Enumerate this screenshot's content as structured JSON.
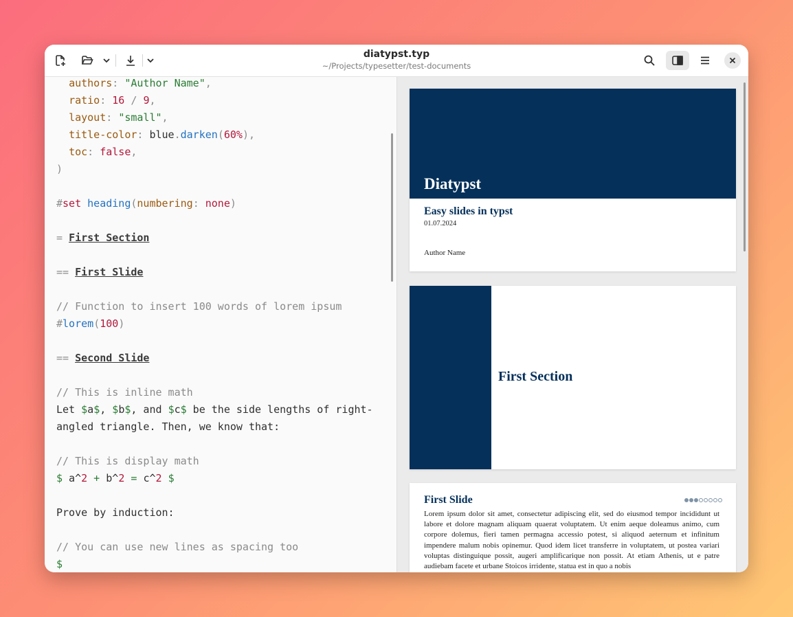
{
  "window": {
    "title": "diatypst.typ",
    "subtitle": "~/Projects/typesetter/test-documents"
  },
  "toolbar": {
    "new_icon": "new-document-icon",
    "open_icon": "folder-open-icon",
    "open_more_icon": "chevron-down-icon",
    "export_icon": "download-icon",
    "export_more_icon": "chevron-down-icon",
    "search_icon": "search-icon",
    "preview_toggle_icon": "sidebar-toggle-icon",
    "menu_icon": "hamburger-menu-icon",
    "close_icon": "close-icon"
  },
  "editor": {
    "lines": [
      [
        {
          "t": "  "
        },
        {
          "t": "authors",
          "c": "k"
        },
        {
          "t": ": ",
          "c": "p"
        },
        {
          "t": "\"Author Name\"",
          "c": "s"
        },
        {
          "t": ",",
          "c": "p"
        }
      ],
      [
        {
          "t": "  "
        },
        {
          "t": "ratio",
          "c": "k"
        },
        {
          "t": ": ",
          "c": "p"
        },
        {
          "t": "16",
          "c": "n"
        },
        {
          "t": " / ",
          "c": "p"
        },
        {
          "t": "9",
          "c": "n"
        },
        {
          "t": ",",
          "c": "p"
        }
      ],
      [
        {
          "t": "  "
        },
        {
          "t": "layout",
          "c": "k"
        },
        {
          "t": ": ",
          "c": "p"
        },
        {
          "t": "\"small\"",
          "c": "s"
        },
        {
          "t": ",",
          "c": "p"
        }
      ],
      [
        {
          "t": "  "
        },
        {
          "t": "title-color",
          "c": "k"
        },
        {
          "t": ": ",
          "c": "p"
        },
        {
          "t": "blue"
        },
        {
          "t": ".",
          "c": "p"
        },
        {
          "t": "darken",
          "c": "f"
        },
        {
          "t": "(",
          "c": "p"
        },
        {
          "t": "60%",
          "c": "n"
        },
        {
          "t": "),",
          "c": "p"
        }
      ],
      [
        {
          "t": "  "
        },
        {
          "t": "toc",
          "c": "k"
        },
        {
          "t": ": ",
          "c": "p"
        },
        {
          "t": "false",
          "c": "n"
        },
        {
          "t": ",",
          "c": "p"
        }
      ],
      [
        {
          "t": ")",
          "c": "p"
        }
      ],
      [
        {
          "t": ""
        }
      ],
      [
        {
          "t": "#",
          "c": "p"
        },
        {
          "t": "set",
          "c": "kw"
        },
        {
          "t": " "
        },
        {
          "t": "heading",
          "c": "f"
        },
        {
          "t": "(",
          "c": "p"
        },
        {
          "t": "numbering",
          "c": "k"
        },
        {
          "t": ": ",
          "c": "p"
        },
        {
          "t": "none",
          "c": "n"
        },
        {
          "t": ")",
          "c": "p"
        }
      ],
      [
        {
          "t": ""
        }
      ],
      [
        {
          "t": "= ",
          "c": "p"
        },
        {
          "t": "First Section",
          "c": "h"
        }
      ],
      [
        {
          "t": ""
        }
      ],
      [
        {
          "t": "== ",
          "c": "p"
        },
        {
          "t": "First Slide",
          "c": "h"
        }
      ],
      [
        {
          "t": ""
        }
      ],
      [
        {
          "t": "// Function to insert 100 words of lorem ipsum",
          "c": "c"
        }
      ],
      [
        {
          "t": "#",
          "c": "p"
        },
        {
          "t": "lorem",
          "c": "f"
        },
        {
          "t": "(",
          "c": "p"
        },
        {
          "t": "100",
          "c": "n"
        },
        {
          "t": ")",
          "c": "p"
        }
      ],
      [
        {
          "t": ""
        }
      ],
      [
        {
          "t": "== ",
          "c": "p"
        },
        {
          "t": "Second Slide",
          "c": "h"
        }
      ],
      [
        {
          "t": ""
        }
      ],
      [
        {
          "t": "// This is inline math",
          "c": "c"
        }
      ],
      [
        {
          "t": "Let "
        },
        {
          "t": "$",
          "c": "m"
        },
        {
          "t": "a"
        },
        {
          "t": "$",
          "c": "m"
        },
        {
          "t": ", "
        },
        {
          "t": "$",
          "c": "m"
        },
        {
          "t": "b"
        },
        {
          "t": "$",
          "c": "m"
        },
        {
          "t": ", and "
        },
        {
          "t": "$",
          "c": "m"
        },
        {
          "t": "c"
        },
        {
          "t": "$",
          "c": "m"
        },
        {
          "t": " be the side lengths of right-"
        }
      ],
      [
        {
          "t": "angled triangle. Then, we know that:"
        }
      ],
      [
        {
          "t": ""
        }
      ],
      [
        {
          "t": "// This is display math",
          "c": "c"
        }
      ],
      [
        {
          "t": "$",
          "c": "m"
        },
        {
          "t": " a^"
        },
        {
          "t": "2",
          "c": "n"
        },
        {
          "t": " + ",
          "c": "m"
        },
        {
          "t": "b^"
        },
        {
          "t": "2",
          "c": "n"
        },
        {
          "t": " = ",
          "c": "m"
        },
        {
          "t": "c^"
        },
        {
          "t": "2",
          "c": "n"
        },
        {
          "t": " "
        },
        {
          "t": "$",
          "c": "m"
        }
      ],
      [
        {
          "t": ""
        }
      ],
      [
        {
          "t": "Prove by induction:"
        }
      ],
      [
        {
          "t": ""
        }
      ],
      [
        {
          "t": "// You can use new lines as spacing too",
          "c": "c"
        }
      ],
      [
        {
          "t": "$",
          "c": "m"
        }
      ]
    ]
  },
  "preview": {
    "slide1": {
      "title": "Diatypst",
      "subtitle": "Easy slides in typst",
      "date": "01.07.2024",
      "author": "Author Name"
    },
    "slide2": {
      "section": "First Section"
    },
    "slide3": {
      "title": "First Slide",
      "progress_filled": 3,
      "progress_total": 8,
      "body": "Lorem ipsum dolor sit amet, consectetur adipiscing elit, sed do eiusmod tempor incididunt ut labore et dolore magnam aliquam quaerat voluptatem. Ut enim aeque doleamus animo, cum corpore dolemus, fieri tamen permagna accessio potest, si aliquod aeternum et infinitum impendere malum nobis opinemur. Quod idem licet transferre in voluptatem, ut postea variari voluptas distinguique possit, augeri amplificarique non possit. At etiam Athenis, ut e patre audiebam facete et urbane Stoicos irridente, statua est in quo a nobis"
    },
    "colors": {
      "navy": "#04305a"
    }
  }
}
